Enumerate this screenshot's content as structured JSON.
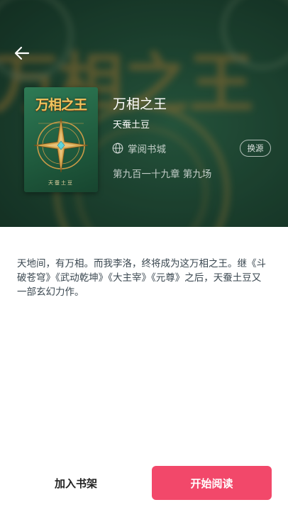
{
  "book": {
    "title": "万相之王",
    "author": "天蚕土豆",
    "cover_title": "万相之王",
    "cover_author": "天蚕土豆",
    "source_name": "掌阅书城",
    "switch_source_label": "换源",
    "latest_chapter": "第九百一十九章 第九场",
    "description": "天地间，有万相。而我李洛，终将成为这万相之王。继《斗破苍穹》《武动乾坤》《大主宰》《元尊》之后，天蚕土豆又一部玄幻力作。"
  },
  "actions": {
    "add_to_shelf": "加入书架",
    "start_reading": "开始阅读"
  },
  "icons": {
    "back": "arrow-left-icon",
    "source": "globe-icon"
  },
  "colors": {
    "accent": "#f2486a",
    "hero_bg": "#24533c"
  }
}
